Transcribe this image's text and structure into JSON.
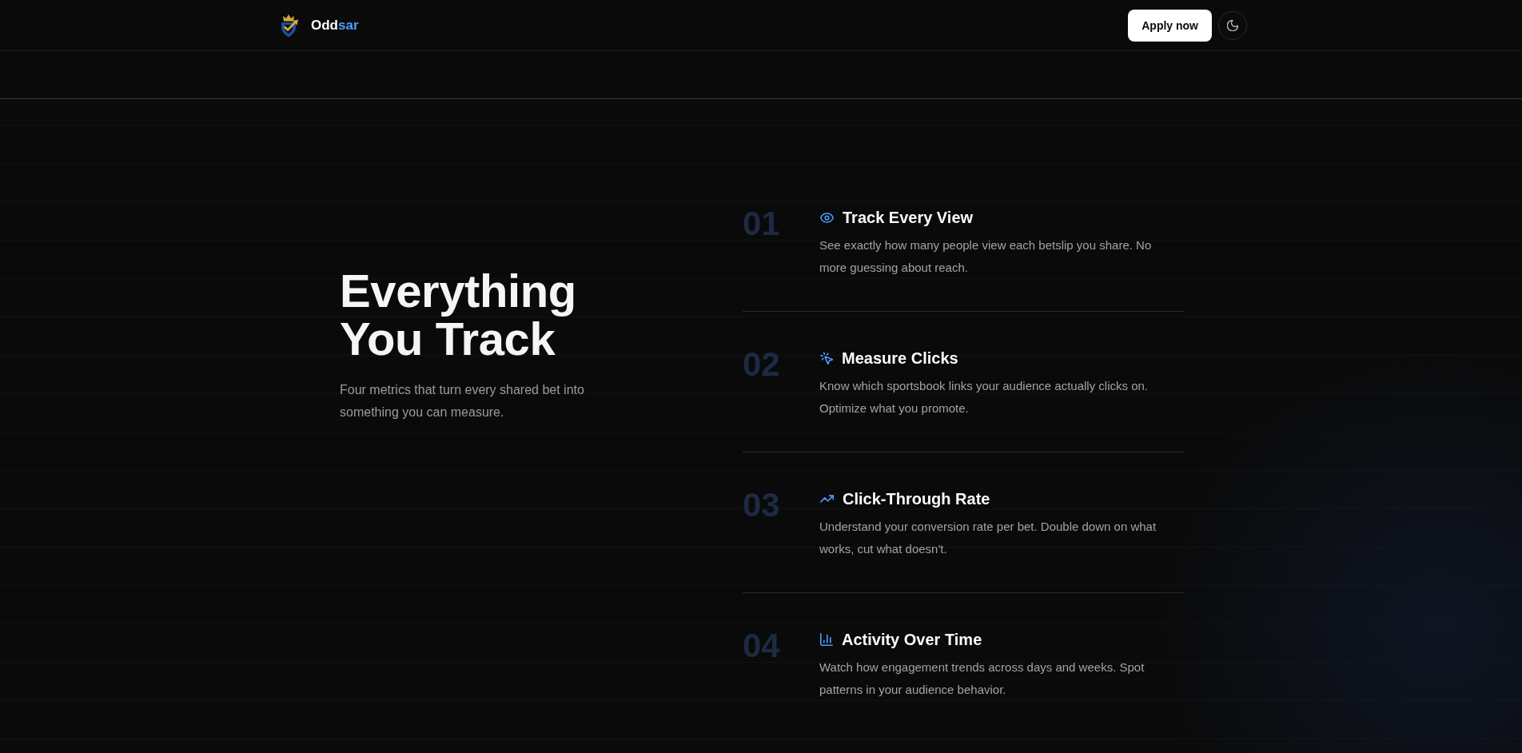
{
  "header": {
    "logo_text": {
      "main": "Odd",
      "accent": "sar"
    },
    "apply_button": "Apply now"
  },
  "intro": {
    "heading": "Everything You Track",
    "subtitle": "Four metrics that turn every shared bet into something you can measure."
  },
  "metrics": [
    {
      "number": "01",
      "kind": "views",
      "title": "Track Every View",
      "description": "See exactly how many people view each betslip you share. No more guessing about reach."
    },
    {
      "number": "02",
      "kind": "clicks",
      "title": "Measure Clicks",
      "description": "Know which sportsbook links your audience actually clicks on. Optimize what you promote."
    },
    {
      "number": "03",
      "kind": "rate",
      "title": "Click-Through Rate",
      "description": "Understand your conversion rate per bet. Double down on what works, cut what doesn't."
    },
    {
      "number": "04",
      "kind": "activity",
      "title": "Activity Over Time",
      "description": "Watch how engagement trends across days and weeks. Spot patterns in your audience behavior."
    }
  ]
}
